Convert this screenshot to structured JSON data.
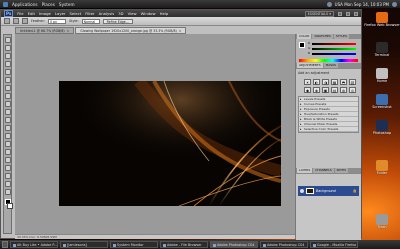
{
  "top_panel": {
    "menus": [
      "Applications",
      "Places",
      "System"
    ],
    "clock": "USA Mon Sep 14, 10:03 PM"
  },
  "photoshop": {
    "logo": "Ps",
    "menus": [
      "File",
      "Edit",
      "Image",
      "Layer",
      "Select",
      "Filter",
      "Analysis",
      "3D",
      "View",
      "Window",
      "Help"
    ],
    "workspace": "ESSENTIALS ▾",
    "options": {
      "feather_label": "Feather:",
      "feather_value": "0 px",
      "style_label": "Style:",
      "style_value": "Normal",
      "refine_button": "Refine Edge..."
    },
    "tabs": [
      {
        "label": "Untitled-1 @ 66.7% (RGB/8)",
        "close": "×"
      },
      {
        "label": "Glowing Wallpaper 1920x1200_orange.jpg @ 33.3% (RGB/8)",
        "close": "×"
      }
    ],
    "status": "33.33%   Doc: 6.59M/6.59M",
    "panels": {
      "color_tabs": [
        "COLOR",
        "SWATCHES",
        "STYLES"
      ],
      "color_sliders": [
        "R",
        "G",
        "B"
      ],
      "adjustment_tabs": [
        "ADJUSTMENTS",
        "MASKS"
      ],
      "adjustment_title": "Add an adjustment",
      "adjustment_icons": [
        "☀",
        "◐",
        "◑",
        "▦",
        "◓",
        "▧",
        "◆",
        "◈",
        "▣",
        "▤",
        "◍",
        "◎"
      ],
      "presets": [
        "Levels Presets",
        "Curves Presets",
        "Exposure Presets",
        "Hue/Saturation Presets",
        "Black & White Presets",
        "Channel Mixer Presets",
        "Selective Color Presets"
      ],
      "layers_tabs": [
        "LAYERS",
        "CHANNELS",
        "PATHS"
      ],
      "layer_name": "Background",
      "layer_lock": "🔒"
    }
  },
  "desktop_icons": [
    {
      "label": "Firefox Web Browser",
      "color": "#e66a12"
    },
    {
      "label": "Terminal",
      "color": "#2b2b2b"
    },
    {
      "label": "Home",
      "color": "#c0c0c0"
    },
    {
      "label": "Screenshot",
      "color": "#3d6fb0"
    },
    {
      "label": "Photoshop",
      "color": "#1b2f55"
    },
    {
      "label": "Folder",
      "color": "#e08a2a"
    },
    {
      "label": "Trash",
      "color": "#9a9a9a"
    }
  ],
  "taskbar": [
    {
      "label": "Alt Buy Lite • Adobe P..."
    },
    {
      "label": "[Jamiesons]"
    },
    {
      "label": "System Monitor"
    },
    {
      "label": "Adobe - File Browser"
    },
    {
      "label": "Adobe Photoshop CS4"
    },
    {
      "label": "Adobe Photoshop CS4"
    },
    {
      "label": "Google - Mozilla Firefox"
    }
  ],
  "colors": {
    "accent_orange": "#e0781c",
    "panel_dark": "#2a2a2a",
    "layer_selected": "#2b4a8f"
  }
}
